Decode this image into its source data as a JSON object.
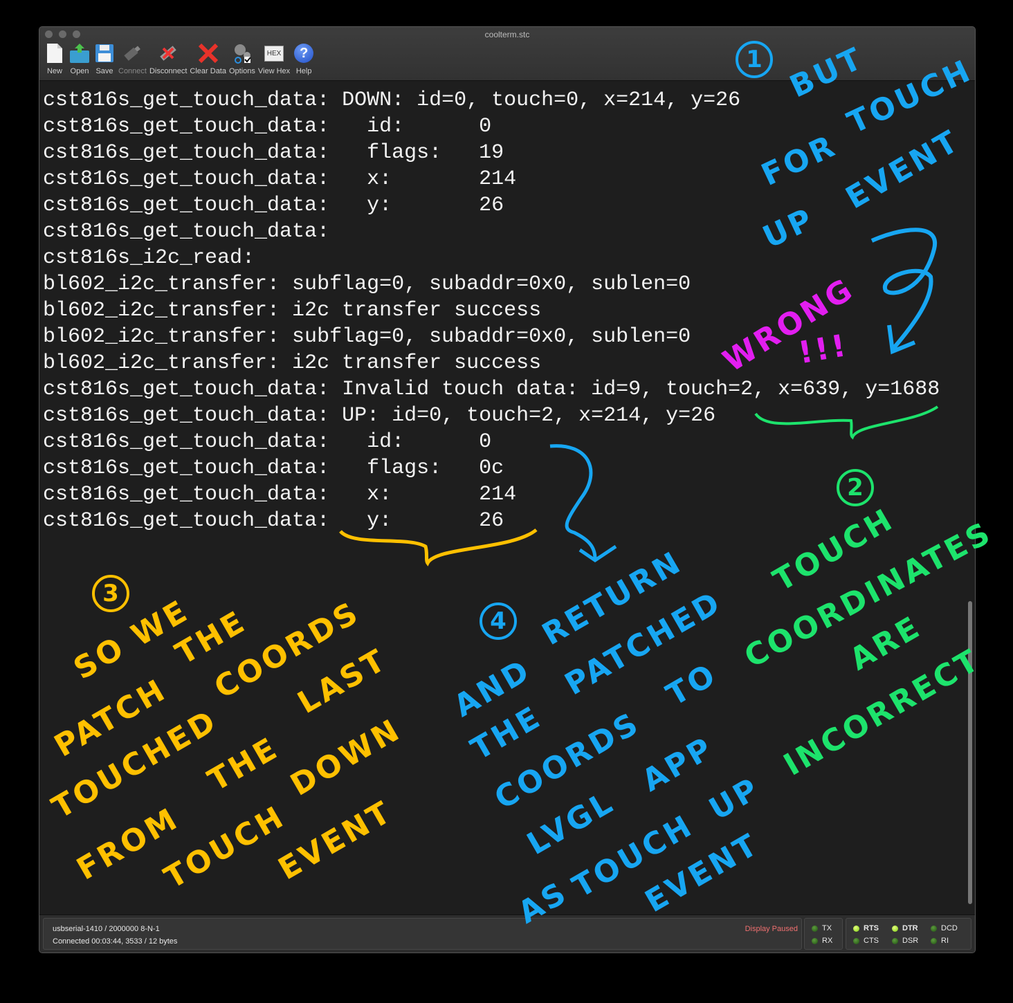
{
  "window": {
    "title": "coolterm.stc"
  },
  "toolbar": [
    {
      "label": "New",
      "icon": "new-file-icon"
    },
    {
      "label": "Open",
      "icon": "open-folder-icon"
    },
    {
      "label": "Save",
      "icon": "save-floppy-icon"
    },
    {
      "label": "Connect",
      "icon": "usb-plug-icon",
      "disabled": true
    },
    {
      "label": "Disconnect",
      "icon": "disconnect-icon"
    },
    {
      "label": "Clear Data",
      "icon": "red-x-icon"
    },
    {
      "label": "Options",
      "icon": "gears-icon"
    },
    {
      "label": "View Hex",
      "icon": "hex-icon",
      "icon_text": "HEX"
    },
    {
      "label": "Help",
      "icon": "help-icon",
      "icon_text": "?"
    }
  ],
  "terminal": {
    "lines": [
      "cst816s_get_touch_data: DOWN: id=0, touch=0, x=214, y=26",
      "cst816s_get_touch_data:   id:      0",
      "cst816s_get_touch_data:   flags:   19",
      "cst816s_get_touch_data:   x:       214",
      "cst816s_get_touch_data:   y:       26",
      "cst816s_get_touch_data:",
      "cst816s_i2c_read:",
      "bl602_i2c_transfer: subflag=0, subaddr=0x0, sublen=0",
      "bl602_i2c_transfer: i2c transfer success",
      "bl602_i2c_transfer: subflag=0, subaddr=0x0, sublen=0",
      "bl602_i2c_transfer: i2c transfer success",
      "cst816s_get_touch_data: Invalid touch data: id=9, touch=2, x=639, y=1688",
      "cst816s_get_touch_data: UP: id=0, touch=2, x=214, y=26",
      "cst816s_get_touch_data:   id:      0",
      "cst816s_get_touch_data:   flags:   0c",
      "cst816s_get_touch_data:   x:       214",
      "cst816s_get_touch_data:   y:       26"
    ]
  },
  "status": {
    "port": "usbserial-1410 / 2000000 8-N-1",
    "connection": "Connected 00:03:44, 3533 / 12 bytes",
    "display": "Display Paused",
    "leds": {
      "TX": "off",
      "RX": "off",
      "RTS": "on",
      "CTS": "off",
      "DTR": "on",
      "DSR": "off",
      "DCD": "off",
      "RI": "off"
    },
    "labels": {
      "tx": "TX",
      "rx": "RX",
      "rts": "RTS",
      "cts": "CTS",
      "dtr": "DTR",
      "dsr": "DSR",
      "dcd": "DCD",
      "ri": "RI"
    }
  },
  "annotations": {
    "colors": {
      "blue": "#17a6f2",
      "green": "#1de36c",
      "yellow": "#ffc000",
      "magenta": "#e21ef0"
    },
    "n1": "1",
    "a1": [
      "BUT",
      "FOR",
      "TOUCH",
      "UP",
      "EVENT"
    ],
    "wrong": [
      "WRONG",
      "!!!"
    ],
    "n2": "2",
    "a2": [
      "TOUCH",
      "COORDINATES",
      "ARE",
      "INCORRECT"
    ],
    "n3": "3",
    "a3": [
      "SO WE",
      "THE",
      "PATCH",
      "COORDS",
      "TOUCHED",
      "LAST",
      "THE",
      "FROM",
      "DOWN",
      "TOUCH",
      "EVENT"
    ],
    "n4": "4",
    "a4": [
      "RETURN",
      "AND",
      "PATCHED",
      "THE",
      "TO",
      "COORDS",
      "APP",
      "LVGL",
      "UP",
      "AS",
      "TOUCH",
      "EVENT"
    ]
  }
}
